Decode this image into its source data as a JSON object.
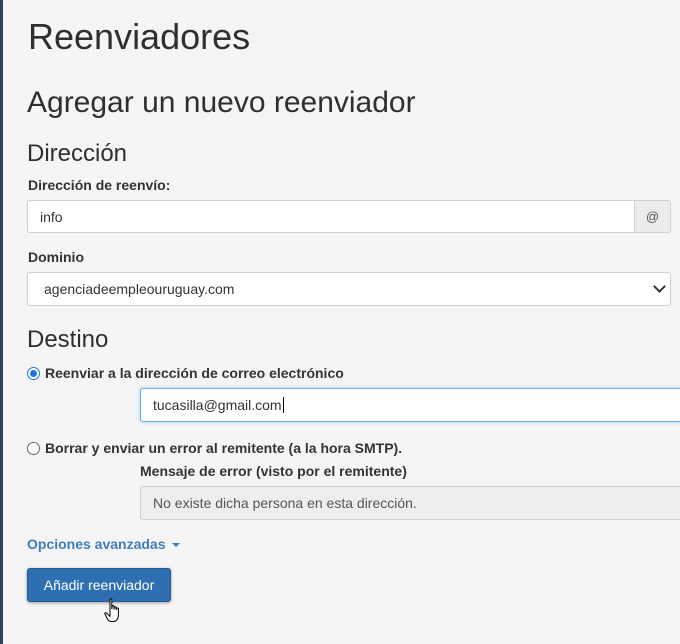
{
  "page": {
    "title": "Reenviadores",
    "section_title": "Agregar un nuevo reenviador"
  },
  "address": {
    "heading": "Dirección",
    "forward_label": "Dirección de reenvío:",
    "forward_value": "info",
    "at_symbol": "@",
    "domain_label": "Dominio",
    "domain_selected": "agenciadeempleouruguay.com"
  },
  "destination": {
    "heading": "Destino",
    "option_forward_label": "Reenviar a la dirección de correo electrónico",
    "option_forward_selected": true,
    "email_value": "tucasilla@gmail.com",
    "option_fail_label": "Borrar y enviar un error al remitente (a la hora SMTP).",
    "option_fail_selected": false,
    "error_message_label": "Mensaje de error (visto por el remitente)",
    "error_message_value": "No existe dicha persona en esta dirección."
  },
  "advanced": {
    "link_label": "Opciones avanzadas"
  },
  "actions": {
    "submit_label": "Añadir reenviador"
  },
  "colors": {
    "primary_button": "#2d6fb0",
    "link": "#3d7fb8",
    "focus_border": "#66afe9",
    "radio_selected": "#1a73e8"
  },
  "icons": {
    "domain_dropdown": "chevron-down-icon",
    "advanced_toggle": "caret-down-icon",
    "cursor": "hand-pointer-icon"
  }
}
